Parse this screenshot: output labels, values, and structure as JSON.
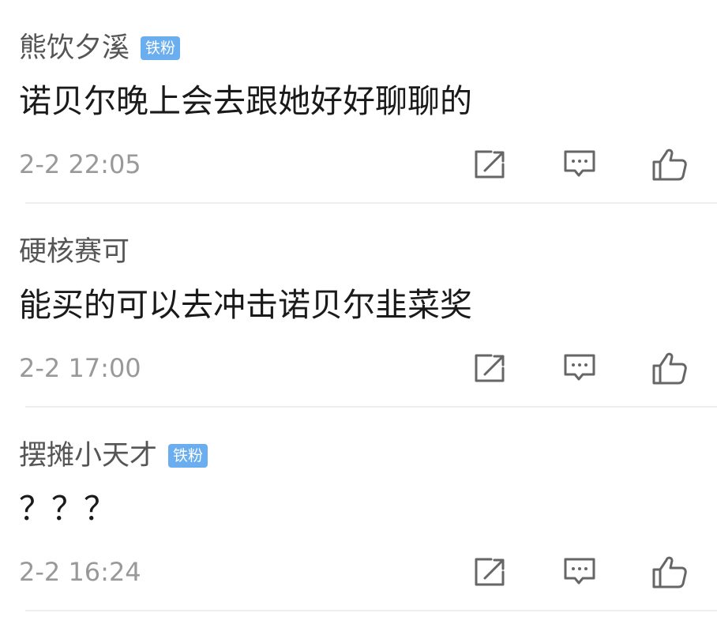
{
  "comments": [
    {
      "user": "熊饮夕溪",
      "badge": "铁粉",
      "text": "诺贝尔晚上会去跟她好好聊聊的",
      "time": "2-2 22:05"
    },
    {
      "user": "硬核赛可",
      "badge": "",
      "text": "能买的可以去冲击诺贝尔韭菜奖",
      "time": "2-2 17:00"
    },
    {
      "user": "摆摊小天才",
      "badge": "铁粉",
      "text": "？？？",
      "time": "2-2 16:24"
    }
  ],
  "icons": {
    "share": "share-icon",
    "reply": "comment-icon",
    "like": "thumbs-up-icon"
  },
  "colors": {
    "badge": "#6aaef0",
    "username": "#555555",
    "content": "#1a1a1a",
    "time": "#999999",
    "icon": "#666666",
    "divider": "#eeeeee"
  }
}
